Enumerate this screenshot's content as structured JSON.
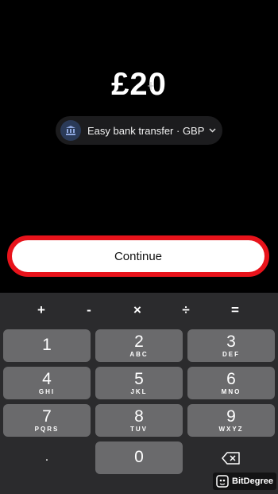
{
  "amount": "£20",
  "payment_method": {
    "label": "Easy bank transfer · GBP",
    "icon": "bank-icon",
    "chevron_icon": "chevron-down-icon"
  },
  "continue_button": {
    "label": "Continue",
    "highlight_color": "#e8131b"
  },
  "keypad": {
    "operators": [
      "+",
      "-",
      "×",
      "÷",
      "="
    ],
    "keys": [
      {
        "digit": "1",
        "letters": ""
      },
      {
        "digit": "2",
        "letters": "ABC"
      },
      {
        "digit": "3",
        "letters": "DEF"
      },
      {
        "digit": "4",
        "letters": "GHI"
      },
      {
        "digit": "5",
        "letters": "JKL"
      },
      {
        "digit": "6",
        "letters": "MNO"
      },
      {
        "digit": "7",
        "letters": "PQRS"
      },
      {
        "digit": "8",
        "letters": "TUV"
      },
      {
        "digit": "9",
        "letters": "WXYZ"
      },
      {
        "digit": ".",
        "letters": ""
      },
      {
        "digit": "0",
        "letters": ""
      }
    ],
    "backspace_icon": "backspace-icon",
    "key_color": "#6a6a6c",
    "background_color": "#2b2b2d"
  },
  "watermark": {
    "text": "BitDegree",
    "icon": "bitdegree-logo-icon"
  }
}
